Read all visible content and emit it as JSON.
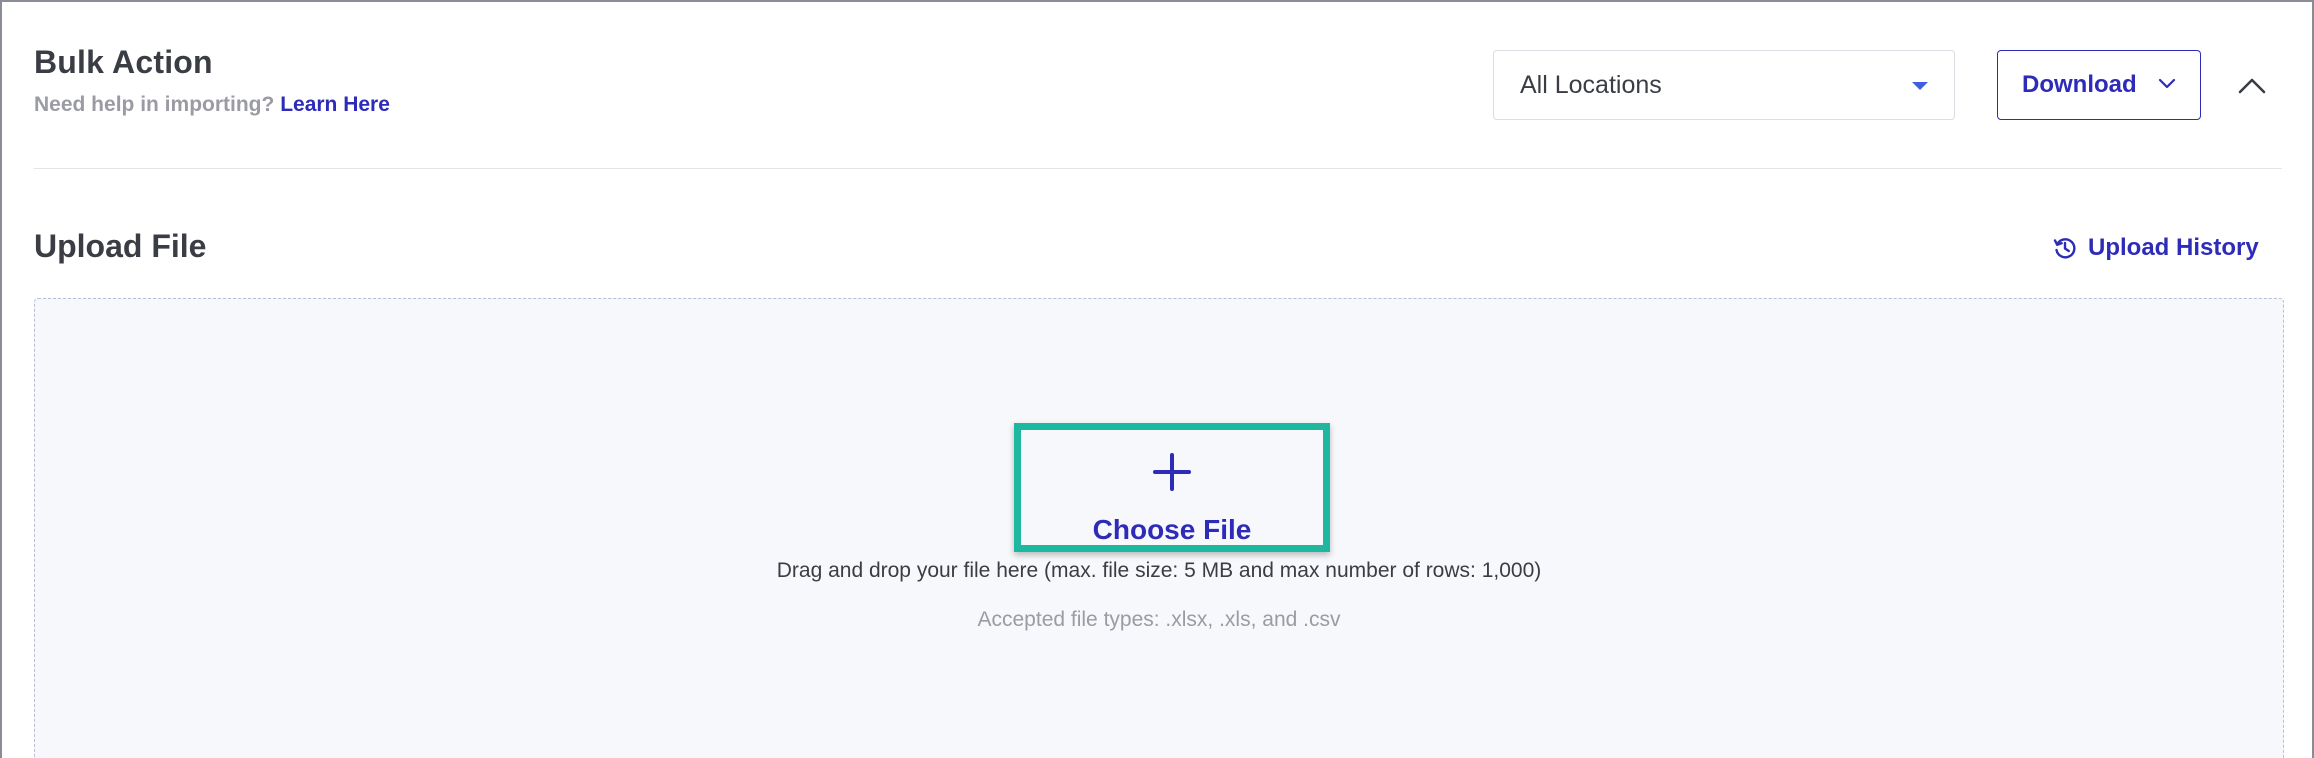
{
  "header": {
    "title": "Bulk Action",
    "help_prefix": "Need help in importing?",
    "help_link": "Learn Here",
    "location_select": {
      "value": "All Locations"
    },
    "download_label": "Download"
  },
  "upload": {
    "title": "Upload File",
    "history_label": "Upload History",
    "choose_file_label": "Choose File",
    "drag_text": "Drag and drop your file here (max. file size: 5 MB and max number of rows: 1,000)",
    "accepted_text": "Accepted file types: .xlsx, .xls, and .csv"
  },
  "colors": {
    "accent": "#2e2bb8",
    "highlight": "#1db89f",
    "caret": "#3f5ee0",
    "muted": "#9a9ba3",
    "dropzone_bg": "#f7f8fc"
  },
  "icons": {
    "caret": "caret-down-icon",
    "download_chevron": "chevron-down-icon",
    "collapse": "chevron-up-icon",
    "history": "history-icon",
    "add": "plus-icon"
  }
}
